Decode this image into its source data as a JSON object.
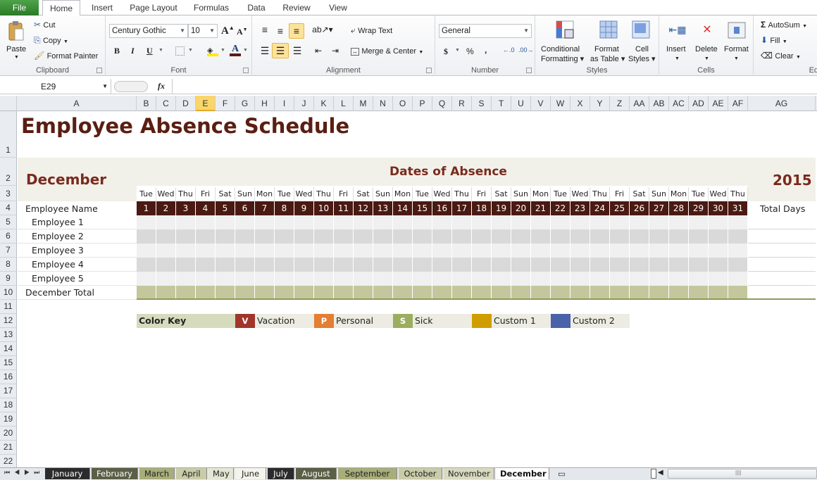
{
  "ribbon_tabs": [
    "File",
    "Home",
    "Insert",
    "Page Layout",
    "Formulas",
    "Data",
    "Review",
    "View"
  ],
  "active_tab": "Home",
  "clipboard": {
    "paste": "Paste",
    "cut": "Cut",
    "copy": "Copy",
    "format_painter": "Format Painter",
    "label": "Clipboard"
  },
  "font": {
    "name": "Century Gothic",
    "size": "10",
    "label": "Font",
    "bold": "B",
    "italic": "I",
    "underline": "U"
  },
  "alignment": {
    "wrap_text": "Wrap Text",
    "merge_center": "Merge & Center",
    "label": "Alignment"
  },
  "number": {
    "format": "General",
    "currency": "$",
    "percent": "%",
    "comma": ",",
    "label": "Number"
  },
  "styles": {
    "conditional": "Conditional",
    "formatting": "Formatting",
    "format_as": "Format",
    "as_table": "as Table",
    "cell": "Cell",
    "cell_styles": "Styles",
    "label": "Styles"
  },
  "cells": {
    "insert": "Insert",
    "delete": "Delete",
    "format": "Format",
    "label": "Cells"
  },
  "editing": {
    "autosum": "AutoSum",
    "fill": "Fill",
    "clear": "Clear",
    "label": "Editi"
  },
  "formula_bar": {
    "name_box": "E29",
    "fx": "fx",
    "value": ""
  },
  "columns": [
    "A",
    "B",
    "C",
    "D",
    "E",
    "F",
    "G",
    "H",
    "I",
    "J",
    "K",
    "L",
    "M",
    "N",
    "O",
    "P",
    "Q",
    "R",
    "S",
    "T",
    "U",
    "V",
    "W",
    "X",
    "Y",
    "Z",
    "AA",
    "AB",
    "AC",
    "AD",
    "AE",
    "AF",
    "AG"
  ],
  "selected_column": "E",
  "rows": [
    "1",
    "2",
    "3",
    "4",
    "5",
    "6",
    "7",
    "8",
    "9",
    "10",
    "11",
    "12",
    "13",
    "14",
    "15",
    "16",
    "17",
    "18",
    "19",
    "20",
    "21",
    "22"
  ],
  "sheet": {
    "title": "Employee Absence Schedule",
    "month": "December",
    "dates_header": "Dates of Absence",
    "year": "2015",
    "weekdays": [
      "Tue",
      "Wed",
      "Thu",
      "Fri",
      "Sat",
      "Sun",
      "Mon",
      "Tue",
      "Wed",
      "Thu",
      "Fri",
      "Sat",
      "Sun",
      "Mon",
      "Tue",
      "Wed",
      "Thu",
      "Fri",
      "Sat",
      "Sun",
      "Mon",
      "Tue",
      "Wed",
      "Thu",
      "Fri",
      "Sat",
      "Sun",
      "Mon",
      "Tue",
      "Wed",
      "Thu"
    ],
    "days": [
      "1",
      "2",
      "3",
      "4",
      "5",
      "6",
      "7",
      "8",
      "9",
      "10",
      "11",
      "12",
      "13",
      "14",
      "15",
      "16",
      "17",
      "18",
      "19",
      "20",
      "21",
      "22",
      "23",
      "24",
      "25",
      "26",
      "27",
      "28",
      "29",
      "30",
      "31"
    ],
    "employee_name_header": "Employee Name",
    "total_days_header": "Total Days",
    "employees": [
      "Employee 1",
      "Employee 2",
      "Employee 3",
      "Employee 4",
      "Employee 5"
    ],
    "total_row": "December Total"
  },
  "color_key": {
    "label": "Color Key",
    "items": [
      {
        "code": "V",
        "label": "Vacation",
        "color": "#a2352a"
      },
      {
        "code": "P",
        "label": "Personal",
        "color": "#e37e32"
      },
      {
        "code": "S",
        "label": "Sick",
        "color": "#9aae5e"
      },
      {
        "code": "",
        "label": "Custom 1",
        "color": "#d09d00"
      },
      {
        "code": "",
        "label": "Custom 2",
        "color": "#4a62a9"
      }
    ]
  },
  "sheet_tabs": [
    "January",
    "February",
    "March",
    "April",
    "May",
    "June",
    "July",
    "August",
    "September",
    "October",
    "November",
    "December"
  ],
  "active_sheet": "December",
  "colors": {
    "dark_brown": "#4a1a12",
    "title_brown": "#5a1e12",
    "olive": "#c4c79c",
    "band_light": "#f0f0ee",
    "band_dark": "#d9d9d9",
    "header_bg": "#f1f1ea"
  }
}
